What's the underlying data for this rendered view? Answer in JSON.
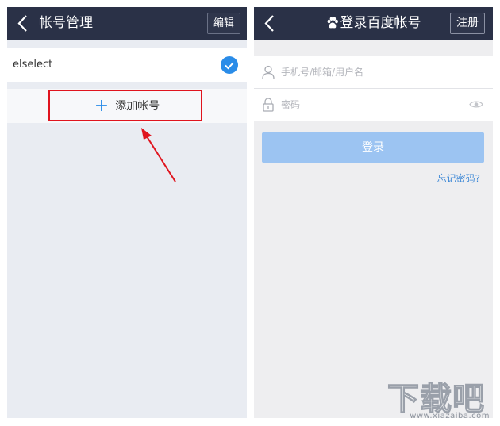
{
  "left_screen": {
    "title": "帐号管理",
    "edit_label": "编辑",
    "account": {
      "name": "elselect",
      "selected": true
    },
    "add_account_label": "添加帐号"
  },
  "right_screen": {
    "title": "登录百度帐号",
    "register_label": "注册",
    "phone_field": {
      "placeholder": "手机号/邮箱/用户名",
      "value": ""
    },
    "password_field": {
      "placeholder": "密码",
      "value": ""
    },
    "login_label": "登录",
    "forgot_label": "忘记密码?"
  },
  "watermark": {
    "main": "下载吧",
    "domain": "www.xiazaiba.com"
  },
  "colors": {
    "navbar": "#2a3147",
    "accent": "#2a8ce8",
    "highlight": "#e0141e",
    "login_button": "#9cc4f2",
    "link": "#3b87d6"
  },
  "icons": [
    "back-chevron-icon",
    "checkmark-icon",
    "plus-icon",
    "paw-icon",
    "user-icon",
    "lock-icon",
    "eye-icon"
  ]
}
